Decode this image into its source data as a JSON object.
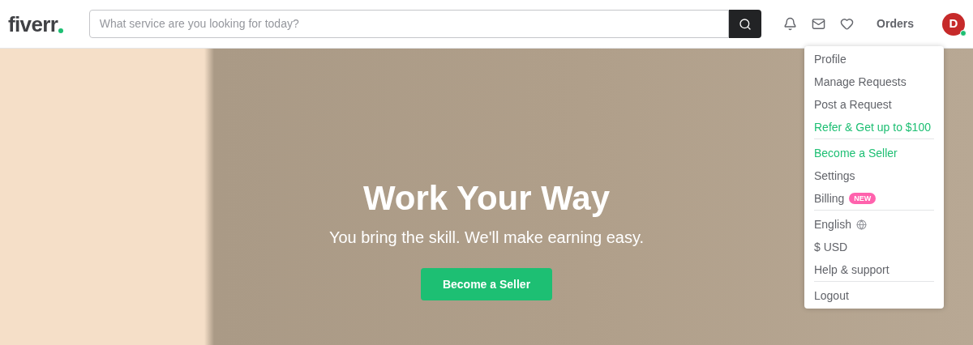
{
  "header": {
    "logo": "fiverr",
    "search": {
      "placeholder": "What service are you looking for today?"
    },
    "orders": "Orders",
    "avatar": {
      "initial": "D",
      "online": true
    }
  },
  "hero": {
    "title": "Work Your Way",
    "subtitle": "You bring the skill. We'll make earning easy.",
    "button": "Become a Seller"
  },
  "menu": {
    "groups": [
      {
        "items": [
          {
            "label": "Profile",
            "kind": "plain"
          },
          {
            "label": "Manage Requests",
            "kind": "plain"
          },
          {
            "label": "Post a Request",
            "kind": "plain"
          },
          {
            "label": "Refer & Get up to $100",
            "kind": "promo"
          }
        ]
      },
      {
        "items": [
          {
            "label": "Become a Seller",
            "kind": "promo"
          },
          {
            "label": "Settings",
            "kind": "plain"
          },
          {
            "label": "Billing",
            "kind": "plain",
            "badge": "NEW"
          }
        ]
      },
      {
        "items": [
          {
            "label": "English",
            "kind": "language"
          },
          {
            "label": "$ USD",
            "kind": "plain"
          },
          {
            "label": "Help & support",
            "kind": "plain"
          }
        ]
      },
      {
        "items": [
          {
            "label": "Logout",
            "kind": "plain"
          }
        ]
      }
    ]
  }
}
